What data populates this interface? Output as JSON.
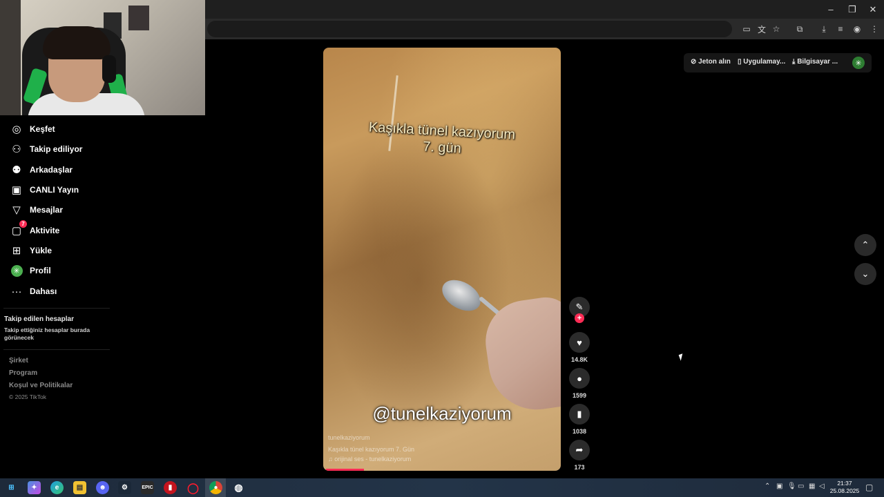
{
  "window_controls": {
    "minimize": "–",
    "restore": "❐",
    "close": "✕"
  },
  "sidebar": {
    "items": [
      {
        "label": "Keşfet",
        "icon": "compass-icon"
      },
      {
        "label": "Takip ediliyor",
        "icon": "user-follow-icon"
      },
      {
        "label": "Arkadaşlar",
        "icon": "friends-icon"
      },
      {
        "label": "CANLI Yayın",
        "icon": "live-tv-icon"
      },
      {
        "label": "Mesajlar",
        "icon": "send-message-icon"
      },
      {
        "label": "Aktivite",
        "icon": "activity-chat-icon",
        "badge": "7"
      },
      {
        "label": "Yükle",
        "icon": "upload-plus-icon"
      },
      {
        "label": "Profil",
        "icon": "profile-avatar-icon"
      },
      {
        "label": "Dahası",
        "icon": "more-dots-icon"
      }
    ],
    "followed_title": "Takip edilen hesaplar",
    "followed_text": "Takip ettiğiniz hesaplar burada görünecek",
    "footer": [
      "Şirket",
      "Program",
      "Koşul ve Politikalar"
    ],
    "copyright": "© 2025 TikTok"
  },
  "video": {
    "caption_line1": "Kaşıkla tünel kazıyorum",
    "caption_line2": "7. gün",
    "watermark": "@tunelkaziyorum",
    "author": "tunelkaziyorum",
    "description": "Kaşıkla tünel kazıyorum 7. Gün",
    "sound": "♫ orijinal ses - tunelkaziyorum",
    "progress_fraction": 0.16
  },
  "actions": {
    "likes": "14.8K",
    "comments": "1599",
    "saves": "1038",
    "shares": "173"
  },
  "topbar": {
    "coins": "Jeton alın",
    "app": "Uygulamay...",
    "pc": "Bilgisayar ..."
  },
  "taskbar": {
    "time": "21:37",
    "date": "25.08.2025",
    "apps": [
      "windows-start",
      "copilot",
      "edge",
      "file-explorer",
      "discord",
      "steam",
      "epic-games",
      "app-red",
      "opera",
      "chrome",
      "app-circle"
    ]
  }
}
